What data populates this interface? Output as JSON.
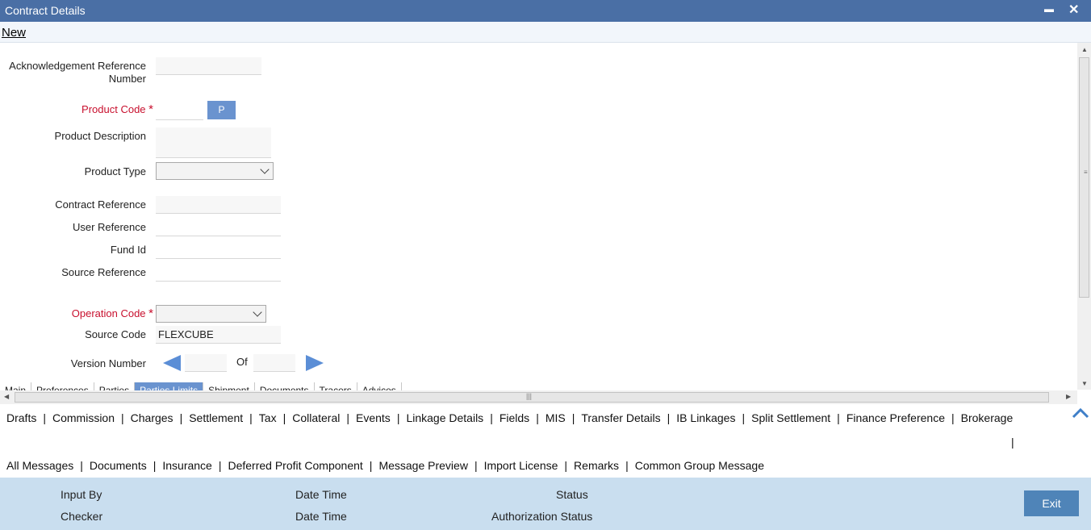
{
  "window": {
    "title": "Contract Details",
    "minimize_glyph": "▬",
    "close_glyph": "✕"
  },
  "menu": {
    "new_label": "New"
  },
  "form": {
    "ack_ref_label_line1": "Acknowledgement Reference",
    "ack_ref_label_line2": "Number",
    "product_code_label": "Product Code",
    "required_marker": "*",
    "p_button_label": "P",
    "product_description_label": "Product Description",
    "product_type_label": "Product Type",
    "contract_reference_label": "Contract Reference",
    "user_reference_label": "User Reference",
    "fund_id_label": "Fund Id",
    "source_reference_label": "Source Reference",
    "operation_code_label": "Operation Code",
    "source_code_label": "Source Code",
    "source_code_value": "FLEXCUBE",
    "version_number_label": "Version Number",
    "of_label": "Of"
  },
  "tabs": [
    "Main",
    "Preferences",
    "Parties",
    "Parties Limits",
    "Shipment",
    "Documents",
    "Tracers",
    "Advices"
  ],
  "active_tab": "Parties Limits",
  "links_row1": [
    "Drafts",
    "Commission",
    "Charges",
    "Settlement",
    "Tax",
    "Collateral",
    "Events",
    "Linkage Details",
    "Fields",
    "MIS",
    "Transfer Details",
    "IB Linkages",
    "Split Settlement",
    "Finance Preference",
    "Brokerage"
  ],
  "links_row1_trailing_sep": "|",
  "links_row2": [
    "All Messages",
    "Documents",
    "Insurance",
    "Deferred Profit Component",
    "Message Preview",
    "Import License",
    "Remarks",
    "Common Group Message"
  ],
  "footer": {
    "input_by": "Input By",
    "checker": "Checker",
    "date_time_1": "Date Time",
    "date_time_2": "Date Time",
    "status": "Status",
    "authorization_status": "Authorization Status",
    "exit_label": "Exit"
  },
  "colors": {
    "titlebar": "#4a6fa5",
    "accent": "#6a93cf",
    "required": "#c8102e",
    "footer": "#c9deef",
    "exit": "#4f84b8"
  }
}
